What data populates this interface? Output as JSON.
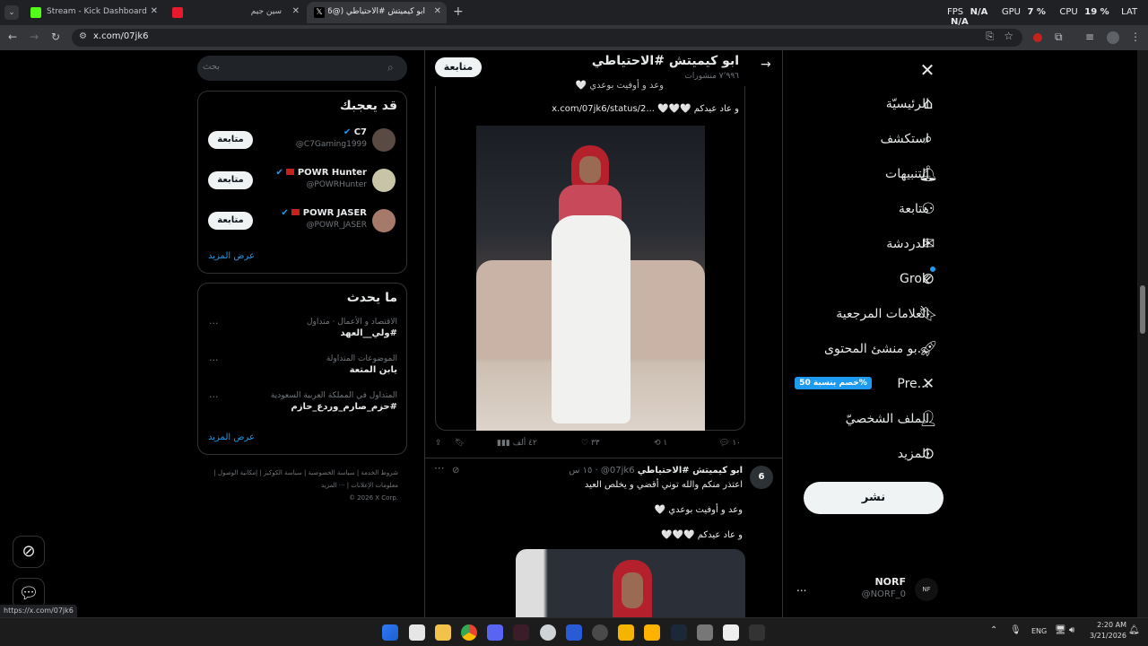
{
  "browser": {
    "tabs": [
      {
        "title": "Stream - Kick Dashboard",
        "active": false,
        "favicon_color": "#53fc18"
      },
      {
        "title": "",
        "active": false,
        "favicon_color": "#e8192c"
      },
      {
        "title": "سين جيم",
        "active": false,
        "favicon_color": ""
      },
      {
        "title": "ابو كيميتش #الاحتياطي (@07jk6",
        "active": true,
        "favicon_color": "#ffffff"
      }
    ],
    "address": "x.com/07jk6",
    "status_url": "https://x.com/07jk6",
    "perf": {
      "fps_label": "FPS",
      "fps_value": "N/A",
      "gpu_label": "GPU",
      "gpu_value": "7 %",
      "cpu_label": "CPU",
      "cpu_value": "19 %",
      "lat_label": "LAT",
      "lat_value": "N/A"
    }
  },
  "nav": {
    "items": [
      {
        "label": "الرئيسيّة",
        "icon": "home-icon"
      },
      {
        "label": "استكشف",
        "icon": "search-icon"
      },
      {
        "label": "التنبيهات",
        "icon": "bell-icon"
      },
      {
        "label": "متابعة",
        "icon": "follow-icon"
      },
      {
        "label": "الدردشة",
        "icon": "mail-icon"
      },
      {
        "label": "Grok",
        "icon": "grok-icon"
      },
      {
        "label": "العلامات المرجعية",
        "icon": "bookmark-icon"
      },
      {
        "label": "...بو منشئ المحتوى",
        "icon": "rocket-icon"
      },
      {
        "label": "...Pre",
        "icon": "x-logo-icon"
      },
      {
        "label": "الملف الشخصيّ",
        "icon": "profile-icon"
      },
      {
        "label": "المزيد",
        "icon": "more-icon"
      }
    ],
    "premium_badge": "%خصم بنسبة 50",
    "post_button": "نشر",
    "account": {
      "name": "NORF",
      "handle": "@NORF_0",
      "more": "..."
    }
  },
  "profile_header": {
    "name": "ابو كيميتش #الاحتياطي",
    "posts_count": "٧٬٩٩٦ منشورات",
    "follow_label": "متابعة"
  },
  "tweet1": {
    "text_line1": "وعد و أوفيت بوعدي",
    "text_line2": "و عاد عيدكم",
    "link": "x.com/07jk6/status/2...",
    "stats": {
      "replies": "١٠",
      "reposts": "١",
      "likes": "٣٣",
      "views": "٤٢ ألف"
    }
  },
  "tweet2": {
    "name": "ابو كيميتش #الاحتياطي",
    "handle": "@07jk6",
    "time": "١٥ س",
    "text_line1": "اعتذر منكم والله توني أقضي و يخلص العيد",
    "text_line2": "وعد و أوفيت بوعدي",
    "text_line3": "و عاد عيدكم"
  },
  "sidebar": {
    "search_placeholder": "بحث",
    "who_to_follow": {
      "title": "قد يعجبك",
      "users": [
        {
          "name": "C7",
          "handle": "@C7Gaming1999",
          "follow": "متابعة"
        },
        {
          "name": "POWR Hunter",
          "handle": "@POWRHunter",
          "follow": "متابعة"
        },
        {
          "name": "POWR JASER",
          "handle": "@POWR_JASER",
          "follow": "متابعة"
        }
      ],
      "show_more": "عرض المزيد"
    },
    "trends": {
      "title": "ما يحدث",
      "items": [
        {
          "context": "الاقتصاد و الأعمال · متداول",
          "name": "#ولي__العهد"
        },
        {
          "context": "الموضوعات المتداولة",
          "name": "يابن المتعة"
        },
        {
          "context": "المتداول في المملكة العربية السعودية",
          "name": "#حزم_صارم_وردع_حازم"
        }
      ],
      "show_more": "عرض المزيد"
    },
    "footer": {
      "links": [
        "شروط الخدمة",
        "سياسة الخصوصية",
        "سياسة الكوكيز",
        "إمكانية الوصول",
        "معلومات الإعلانات",
        "··· المزيد"
      ],
      "copyright": "© 2026 X Corp."
    }
  },
  "taskbar": {
    "lang": "ENG",
    "time": "2:20 AM",
    "date": "3/21/2026"
  }
}
